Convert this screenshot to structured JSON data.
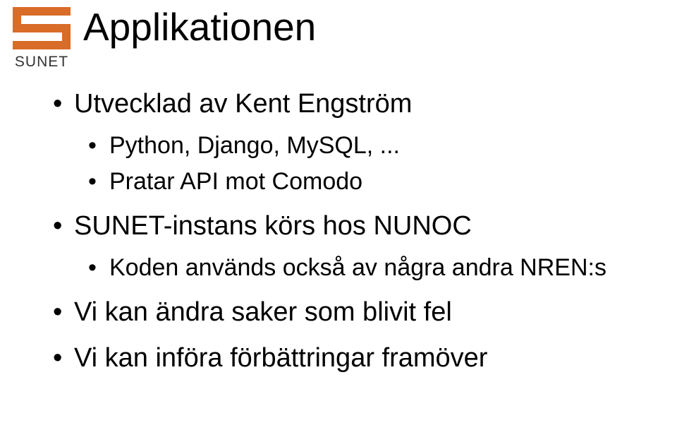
{
  "logo": {
    "text": "SUNET",
    "accent_color": "#d86c28"
  },
  "title": "Applikationen",
  "bullets": [
    {
      "text": "Utvecklad av Kent Engström",
      "children": [
        {
          "text": "Python, Django, MySQL, ..."
        },
        {
          "text": "Pratar API mot Comodo"
        }
      ]
    },
    {
      "text": "SUNET-instans körs hos NUNOC",
      "children": [
        {
          "text": "Koden används också av några andra NREN:s"
        }
      ]
    },
    {
      "text": "Vi kan ändra saker som blivit fel",
      "children": []
    },
    {
      "text": "Vi kan införa förbättringar framöver",
      "children": []
    }
  ]
}
